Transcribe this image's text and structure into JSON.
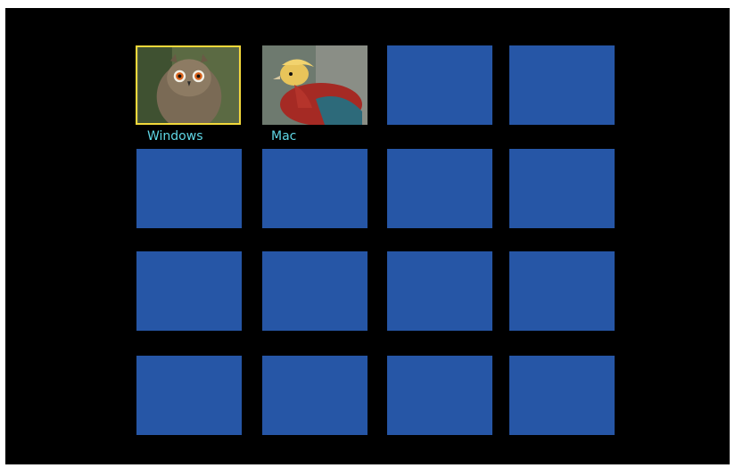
{
  "grid": {
    "accent_color": "#f2d83a",
    "tile_color": "#2656a6",
    "label_color": "#5fd7e6",
    "tiles": [
      {
        "label": "Windows",
        "image": "owl-photo",
        "selected": true
      },
      {
        "label": "Mac",
        "image": "pheasant-photo",
        "selected": false
      }
    ]
  }
}
